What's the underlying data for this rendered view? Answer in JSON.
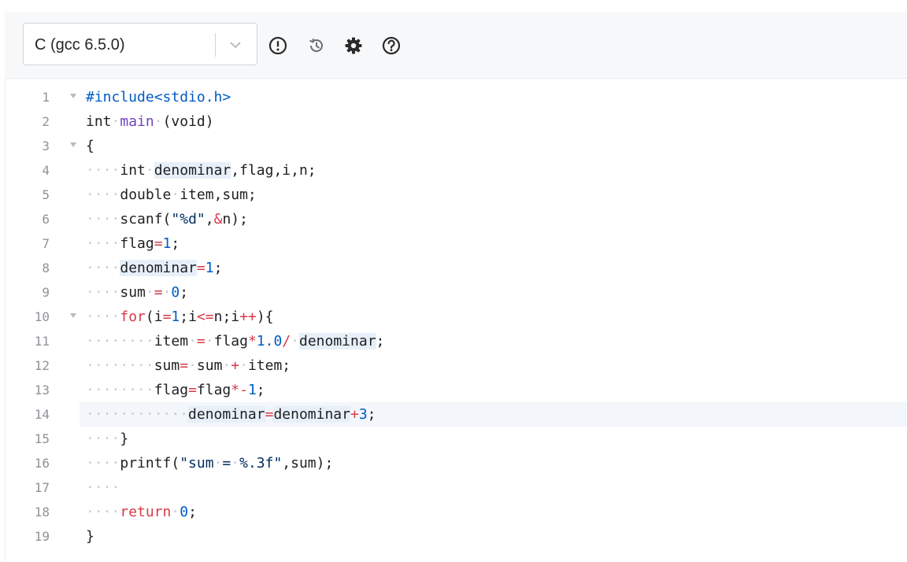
{
  "toolbar": {
    "language": "C (gcc 6.5.0)",
    "icons": [
      "info-icon",
      "history-icon",
      "gear-icon",
      "help-icon"
    ]
  },
  "editor": {
    "active_line": 14,
    "lines": [
      {
        "n": "1",
        "fold": true
      },
      {
        "n": "2",
        "fold": false
      },
      {
        "n": "3",
        "fold": true
      },
      {
        "n": "4",
        "fold": false
      },
      {
        "n": "5",
        "fold": false
      },
      {
        "n": "6",
        "fold": false
      },
      {
        "n": "7",
        "fold": false
      },
      {
        "n": "8",
        "fold": false
      },
      {
        "n": "9",
        "fold": false
      },
      {
        "n": "10",
        "fold": true
      },
      {
        "n": "11",
        "fold": false
      },
      {
        "n": "12",
        "fold": false
      },
      {
        "n": "13",
        "fold": false
      },
      {
        "n": "14",
        "fold": false
      },
      {
        "n": "15",
        "fold": false
      },
      {
        "n": "16",
        "fold": false
      },
      {
        "n": "17",
        "fold": false
      },
      {
        "n": "18",
        "fold": false
      },
      {
        "n": "19",
        "fold": false
      }
    ],
    "code": [
      "#include<stdio.h>",
      "int main (void)",
      "{",
      "    int denominar,flag,i,n;",
      "    double item,sum;",
      "    scanf(\"%d\",&n);",
      "    flag=1;",
      "    denominar=1;",
      "    sum = 0;",
      "    for(i=1;i<=n;i++){",
      "        item = flag*1.0/ denominar;",
      "        sum= sum + item;",
      "        flag=flag*-1;",
      "            denominar=denominar+3;",
      "    }",
      "    printf(\"sum = %.3f\",sum);",
      "    ",
      "    return 0;",
      "}"
    ]
  }
}
